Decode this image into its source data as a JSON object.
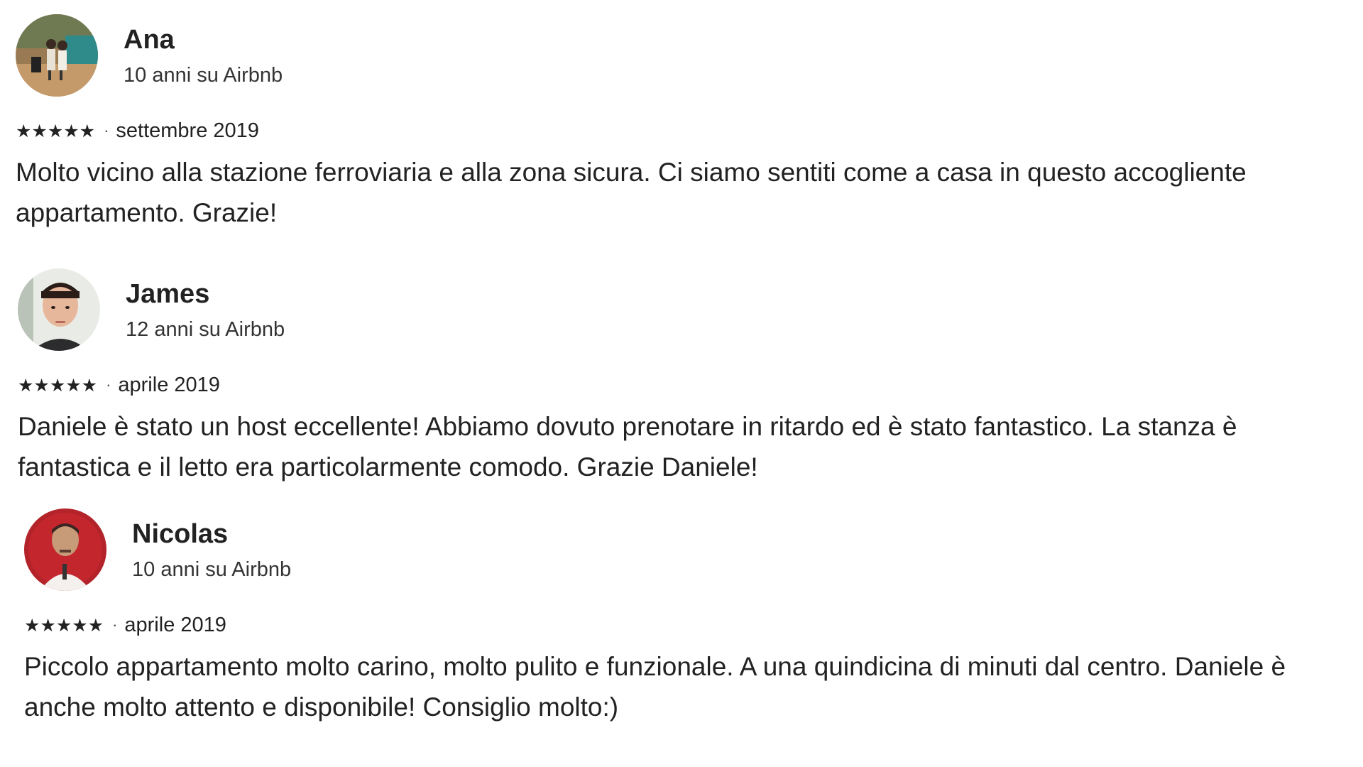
{
  "reviews": [
    {
      "name": "Ana",
      "tenure": "10 anni su Airbnb",
      "stars": "★★★★★",
      "separator": "·",
      "date": "settembre 2019",
      "text": "Molto vicino alla stazione ferroviaria e alla zona sicura. Ci siamo sentiti come a casa in questo accogliente appartamento. Grazie!"
    },
    {
      "name": "James",
      "tenure": "12 anni su Airbnb",
      "stars": "★★★★★",
      "separator": "·",
      "date": "aprile 2019",
      "text": "Daniele è stato un host eccellente! Abbiamo dovuto prenotare in ritardo ed è stato fantastico. La stanza è fantastica e il letto era particolarmente comodo. Grazie Daniele!"
    },
    {
      "name": "Nicolas",
      "tenure": "10 anni su Airbnb",
      "stars": "★★★★★",
      "separator": "·",
      "date": "aprile 2019",
      "text": "Piccolo appartamento molto carino, molto pulito e funzionale. A una quindicina di minuti dal centro. Daniele è anche molto attento e disponibile! Consiglio molto:)"
    }
  ],
  "colors": {
    "text": "#222222",
    "secondary": "#333333",
    "background": "#ffffff"
  }
}
